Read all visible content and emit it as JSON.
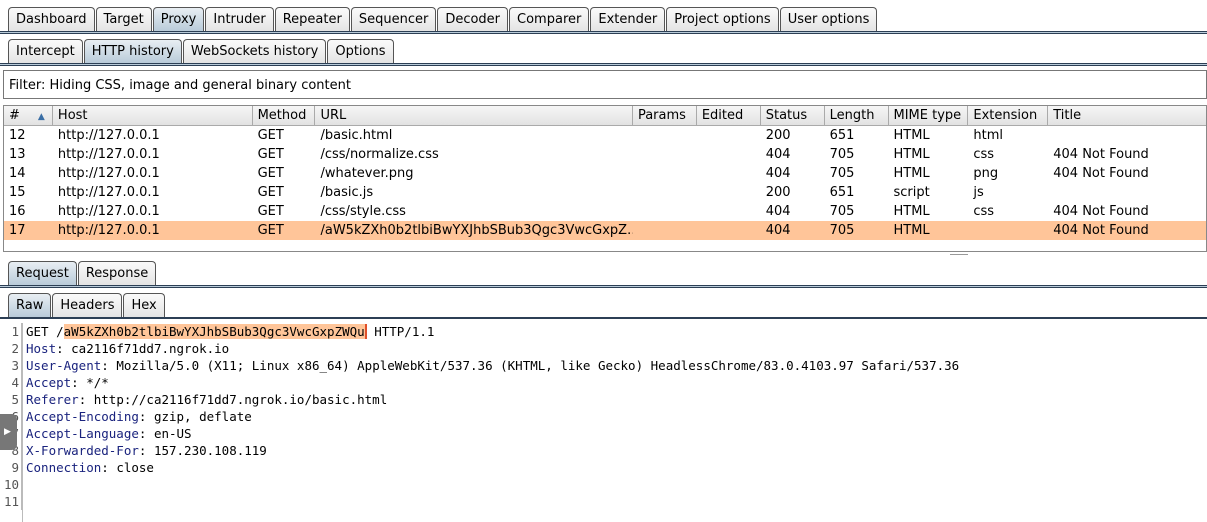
{
  "main_tabs": [
    "Dashboard",
    "Target",
    "Proxy",
    "Intruder",
    "Repeater",
    "Sequencer",
    "Decoder",
    "Comparer",
    "Extender",
    "Project options",
    "User options"
  ],
  "main_active": "Proxy",
  "proxy_tabs": [
    "Intercept",
    "HTTP history",
    "WebSockets history",
    "Options"
  ],
  "proxy_active": "HTTP history",
  "filter": "Filter: Hiding CSS, image and general binary content",
  "table": {
    "sort_icon": "sort-ascending-triangle",
    "columns": [
      "#",
      "Host",
      "Method",
      "URL",
      "Params",
      "Edited",
      "Status",
      "Length",
      "MIME type",
      "Extension",
      "Title"
    ],
    "rows": [
      [
        "12",
        "http://127.0.0.1",
        "GET",
        "/basic.html",
        "",
        "",
        "200",
        "651",
        "HTML",
        "html",
        ""
      ],
      [
        "13",
        "http://127.0.0.1",
        "GET",
        "/css/normalize.css",
        "",
        "",
        "404",
        "705",
        "HTML",
        "css",
        "404 Not Found"
      ],
      [
        "14",
        "http://127.0.0.1",
        "GET",
        "/whatever.png",
        "",
        "",
        "404",
        "705",
        "HTML",
        "png",
        "404 Not Found"
      ],
      [
        "15",
        "http://127.0.0.1",
        "GET",
        "/basic.js",
        "",
        "",
        "200",
        "651",
        "script",
        "js",
        ""
      ],
      [
        "16",
        "http://127.0.0.1",
        "GET",
        "/css/style.css",
        "",
        "",
        "404",
        "705",
        "HTML",
        "css",
        "404 Not Found"
      ],
      [
        "17",
        "http://127.0.0.1",
        "GET",
        "/aW5kZXh0b2tlbiBwYXJhbSBub3Qgc3VwcGxpZ…",
        "",
        "",
        "404",
        "705",
        "HTML",
        "",
        "404 Not Found"
      ]
    ],
    "selected_row": "17",
    "selected_color": "#ffc599"
  },
  "msg_tabs": [
    "Request",
    "Response"
  ],
  "msg_active": "Request",
  "view_tabs": [
    "Raw",
    "Headers",
    "Hex"
  ],
  "view_active": "Raw",
  "request": {
    "method": "GET ",
    "path_prefix": "/",
    "path_highlight": "aW5kZXh0b2tlbiBwYXJhbSBub3Qgc3VwcGxpZWQu",
    "protocol": " HTTP/1.1",
    "headers": [
      [
        "Host",
        ": ca2116f71dd7.ngrok.io"
      ],
      [
        "User-Agent",
        ": Mozilla/5.0 (X11; Linux x86_64) AppleWebKit/537.36 (KHTML, like Gecko) HeadlessChrome/83.0.4103.97 Safari/537.36"
      ],
      [
        "Accept",
        ": */*"
      ],
      [
        "Referer",
        ": http://ca2116f71dd7.ngrok.io/basic.html"
      ],
      [
        "Accept-Encoding",
        ": gzip, deflate"
      ],
      [
        "Accept-Language",
        ": en-US"
      ],
      [
        "X-Forwarded-For",
        ": 157.230.108.119"
      ],
      [
        "Connection",
        ": close"
      ]
    ],
    "line_numbers": [
      "1",
      "2",
      "3",
      "4",
      "5",
      "6",
      "7",
      "8",
      "9",
      "10",
      "11"
    ]
  }
}
